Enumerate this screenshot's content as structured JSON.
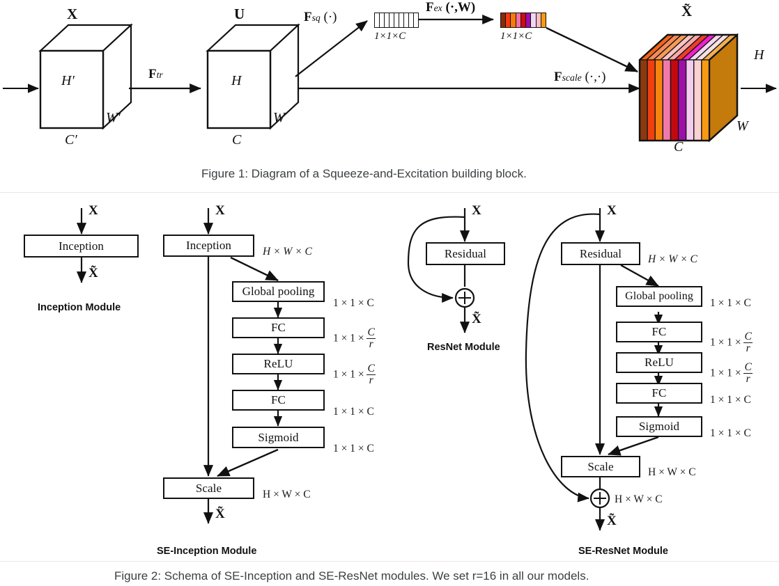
{
  "figure1": {
    "caption": "Figure 1: Diagram of a Squeeze-and-Excitation building block.",
    "labels": {
      "x_tensor": "X",
      "u_tensor": "U",
      "xtilde_tensor": "X̃",
      "f_tr": "F",
      "f_tr_sub": "tr",
      "f_sq": "F",
      "f_sq_sub": "sq",
      "f_sq_arg": "(·)",
      "f_ex": "F",
      "f_ex_sub": "ex",
      "f_ex_arg": "(·,W)",
      "f_scale": "F",
      "f_scale_sub": "scale",
      "f_scale_arg": "(·,·)",
      "h_prime": "H′",
      "w_prime": "W′",
      "c_prime": "C′",
      "h": "H",
      "w": "W",
      "c": "C",
      "h_out": "H",
      "w_out": "W",
      "c_out": "C",
      "vec_dim_1": "1×1×C",
      "vec_dim_2": "1×1×C"
    },
    "squeeze_vector_cells": 9,
    "excite_vector_colors": [
      "#8a2a08",
      "#f43a10",
      "#fb7a0b",
      "#f56fa1",
      "#d50a10",
      "#9c0fa8",
      "#f0d8f0",
      "#f8bcc4",
      "#f79a10"
    ],
    "cube_front_colors": [
      "#8a3a10",
      "#f04010",
      "#f8820e",
      "#f278ab",
      "#c40810",
      "#9c10a8",
      "#f4cdef",
      "#fbd2d2",
      "#f79a14"
    ],
    "cube_top_colors": [
      "#f26418",
      "#f58a5a",
      "#f79a55",
      "#f9c4c4",
      "#f9a8a8",
      "#ef3b2c",
      "#ee22cc",
      "#f2d8f2",
      "#f7e0e0",
      "#f0ae55"
    ],
    "cube_side_color": "#c57a0c"
  },
  "figure2": {
    "caption": "Figure 2: Schema of SE-Inception and SE-ResNet modules. We set r=16 in all our models.",
    "modules": [
      {
        "id": "inception",
        "title": "Inception Module",
        "input_label": "X",
        "output_label": "X̃",
        "blocks": [
          {
            "label": "Inception",
            "dim": ""
          }
        ]
      },
      {
        "id": "se-inception",
        "title": "SE-Inception Module",
        "input_label": "X",
        "output_label": "X̃",
        "blocks": [
          {
            "label": "Inception",
            "dim": "H × W × C"
          },
          {
            "label": "Global pooling",
            "dim": "1 × 1 × C"
          },
          {
            "label": "FC",
            "dim": "1 × 1 × C/r"
          },
          {
            "label": "ReLU",
            "dim": "1 × 1 × C/r"
          },
          {
            "label": "FC",
            "dim": "1 × 1 × C"
          },
          {
            "label": "Sigmoid",
            "dim": "1 × 1 × C"
          },
          {
            "label": "Scale",
            "dim": "H × W × C"
          }
        ]
      },
      {
        "id": "resnet",
        "title": "ResNet Module",
        "input_label": "X",
        "output_label": "X̃",
        "sum_symbol": "+",
        "blocks": [
          {
            "label": "Residual",
            "dim": ""
          }
        ]
      },
      {
        "id": "se-resnet",
        "title": "SE-ResNet Module",
        "input_label": "X",
        "output_label": "X̃",
        "sum_symbol": "+",
        "sum_dim": "H × W × C",
        "blocks": [
          {
            "label": "Residual",
            "dim": "H × W × C"
          },
          {
            "label": "Global pooling",
            "dim": "1 × 1 × C"
          },
          {
            "label": "FC",
            "dim": "1 × 1 × C/r"
          },
          {
            "label": "ReLU",
            "dim": "1 × 1 × C/r"
          },
          {
            "label": "FC",
            "dim": "1 × 1 × C"
          },
          {
            "label": "Sigmoid",
            "dim": "1 × 1 × C"
          },
          {
            "label": "Scale",
            "dim": "H × W × C"
          }
        ]
      }
    ]
  },
  "chart_data": {
    "type": "diagram",
    "title": "Squeeze-and-Excitation building block and SE module schemas",
    "panels": [
      "Figure 1",
      "Figure 2"
    ],
    "reduction_ratio": 16
  }
}
